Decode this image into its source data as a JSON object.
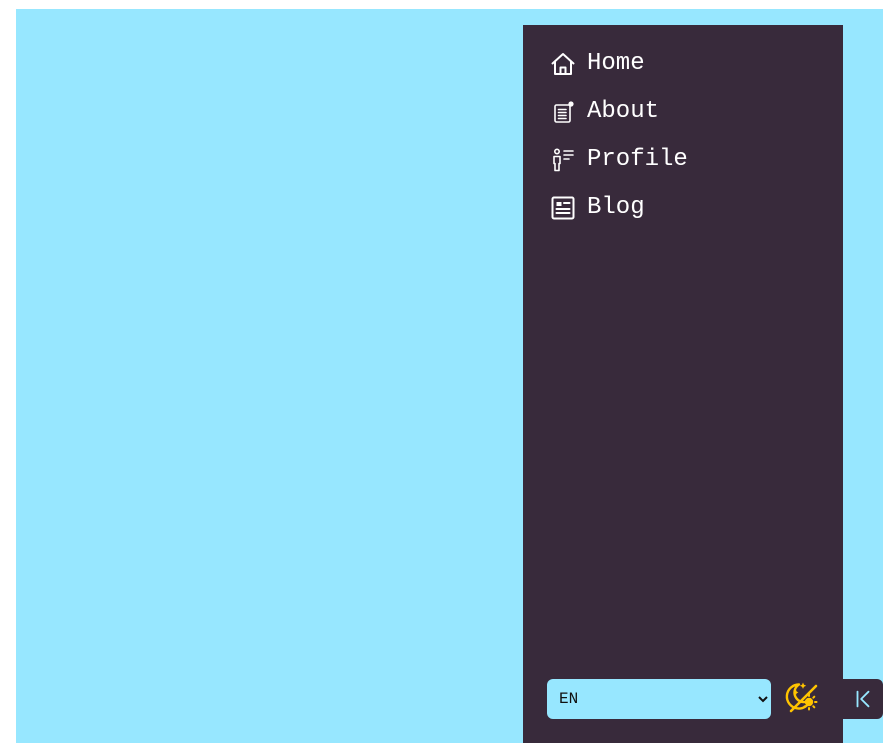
{
  "nav": {
    "items": [
      {
        "label": "Home",
        "icon": "home-icon"
      },
      {
        "label": "About",
        "icon": "about-document-icon"
      },
      {
        "label": "Profile",
        "icon": "profile-person-list-icon"
      },
      {
        "label": "Blog",
        "icon": "blog-newspaper-icon"
      }
    ]
  },
  "footer": {
    "language": {
      "selected": "EN",
      "options": [
        "EN"
      ]
    },
    "theme_toggle_icon": "theme-toggle-icon",
    "collapse_icon": "collapse-sidebar-icon"
  },
  "colors": {
    "page_background": "#97e7ff",
    "sidebar_background": "#382a3b",
    "nav_text": "#ffffff",
    "theme_icon": "#ffc400",
    "collapse_icon": "#97e7ff"
  }
}
